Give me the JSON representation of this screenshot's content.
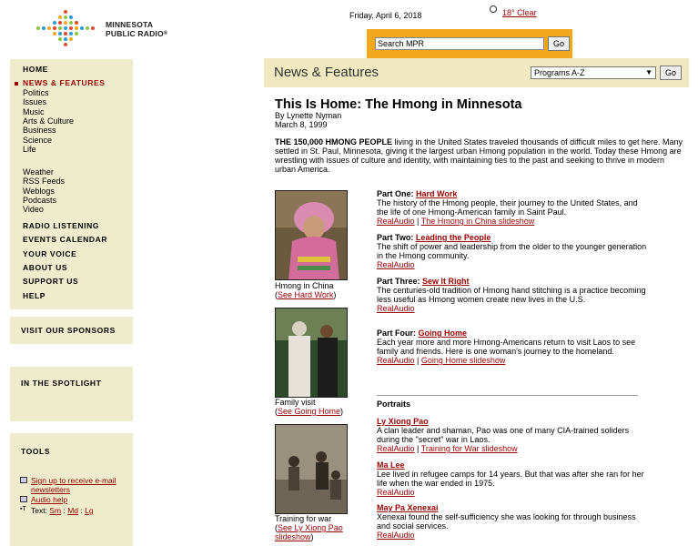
{
  "header": {
    "logo_text_1": "MINNESOTA",
    "logo_text_2": "PUBLIC RADIO",
    "logo_reg": "®",
    "date": "Friday, April 6, 2018",
    "weather": "18° Clear",
    "search_value": "Search MPR",
    "search_go": "Go",
    "accent_color": "#f2a81d"
  },
  "nav": {
    "home": "HOME",
    "news_features": "NEWS & FEATURES",
    "sub1": [
      "Politics",
      "Issues",
      "Music",
      "Arts & Culture",
      "Business",
      "Science",
      "Life"
    ],
    "sub2": [
      "Weather",
      "RSS Feeds",
      "Weblogs",
      "Podcasts",
      "Video"
    ],
    "more": [
      "RADIO LISTENING",
      "EVENTS CALENDAR",
      "YOUR VOICE",
      "ABOUT US",
      "SUPPORT US",
      "HELP"
    ],
    "sponsors": "VISIT OUR SPONSORS",
    "spotlight": "IN THE SPOTLIGHT",
    "tools": "TOOLS",
    "tool_email": "Sign up to receive e-mail newsletters",
    "tool_audio": "Audio help",
    "text_label": "Text:",
    "text_sizes": [
      "Sm",
      "Md",
      "Lg"
    ],
    "text_sep": ":"
  },
  "section": {
    "title": "News & Features",
    "programs": "Programs A-Z",
    "go": "Go"
  },
  "article": {
    "title": "This Is Home: The Hmong in Minnesota",
    "author": "By Lynette Nyman",
    "date": "March 8, 1999",
    "intro_bold": "THE 150,000 HMONG PEOPLE",
    "intro_rest": " living in the United States traveled thousands of difficult miles to get here. Many settled in St. Paul, Minnesota, giving it the largest urban Hmong population in the world. Today these Hmong are wrestling with issues of culture and identity, with maintaining ties to the past and seeking to thrive in modern urban America."
  },
  "photos": [
    {
      "caption": "Hmong in China",
      "link": "See Hard Work",
      "open": "(",
      "close": ")"
    },
    {
      "caption": "Family visit",
      "link": "See Going Home",
      "open": "(",
      "close": ")"
    },
    {
      "caption": "Training for war",
      "link": "See Ly Xiong Pao slideshow",
      "open": "(",
      "close": ")"
    }
  ],
  "parts": [
    {
      "label": "Part One: ",
      "title": "Hard Work",
      "desc": "The history of the Hmong people, their journey to the United States, and the life of one Hmong-American family in Saint Paul.",
      "links": [
        "RealAudio",
        "The Hmong in China slideshow"
      ]
    },
    {
      "label": "Part Two: ",
      "title": "Leading the People",
      "desc": "The shift of power and leadership from the older to the younger generation in the Hmong community.",
      "links": [
        "RealAudio"
      ]
    },
    {
      "label": "Part Three: ",
      "title": "Sew It Right",
      "desc": "The centuries-old tradition of Hmong hand stitching is a practice becoming less useful as Hmong women create new lives in the U.S.",
      "links": [
        "RealAudio"
      ]
    },
    {
      "label": "Part Four: ",
      "title": "Going Home",
      "desc": "Each year more and more Hmong-Americans return to visit Laos to see family and friends. Here is one woman's journey to the homeland.",
      "links": [
        "RealAudio",
        "Going Home slideshow"
      ]
    }
  ],
  "link_sep": " | ",
  "portraits_heading": "Portraits",
  "portraits": [
    {
      "name": "Ly Xiong Pao",
      "desc": "A clan leader and shaman, Pao was one of many CIA-trained soliders during the \"secret\" war in Laos.",
      "links": [
        "RealAudio",
        "Training for War slideshow"
      ]
    },
    {
      "name": "Ma Lee",
      "desc": "Lee lived in refugee camps for 14 years. But that was after she ran for her life when the war ended in 1975.",
      "links": [
        "RealAudio"
      ]
    },
    {
      "name": "May Pa Xenexai",
      "desc": "Xenexai found the self-sufficiency she was looking for through business and social services.",
      "links": [
        "RealAudio"
      ]
    }
  ]
}
